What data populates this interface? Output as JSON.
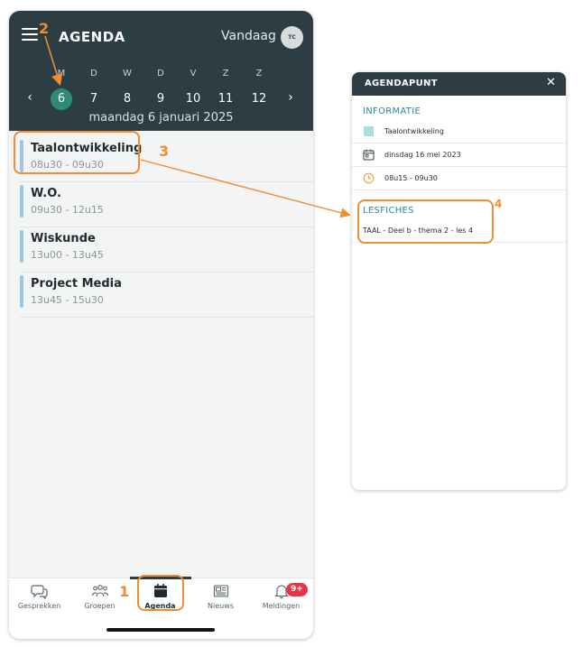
{
  "header": {
    "title": "AGENDA",
    "today_label": "Vandaag",
    "avatar_initials": "TC",
    "weekdays": [
      "M",
      "D",
      "W",
      "D",
      "V",
      "Z",
      "Z"
    ],
    "days": [
      "6",
      "7",
      "8",
      "9",
      "10",
      "11",
      "12"
    ],
    "selected_day": "6",
    "date_line": "maandag 6 januari 2025",
    "prev_icon": "chevron-left-icon",
    "next_icon": "chevron-right-icon",
    "menu_icon": "hamburger-icon"
  },
  "events": [
    {
      "title": "Taalontwikkeling",
      "time": "08u30 - 09u30"
    },
    {
      "title": "W.O.",
      "time": "09u30 - 12u15"
    },
    {
      "title": "Wiskunde",
      "time": "13u00 - 13u45"
    },
    {
      "title": "Project Media",
      "time": "13u45 - 15u30"
    }
  ],
  "tabs": [
    {
      "label": "Gesprekken",
      "icon": "chat-bubbles-icon"
    },
    {
      "label": "Groepen",
      "icon": "people-icon"
    },
    {
      "label": "Agenda",
      "icon": "calendar-icon",
      "active": true
    },
    {
      "label": "Nieuws",
      "icon": "newspaper-icon"
    },
    {
      "label": "Meldingen",
      "icon": "bell-icon",
      "badge": "9+"
    }
  ],
  "panel": {
    "title": "AGENDAPUNT",
    "close_icon": "close-icon",
    "info_heading": "INFORMATIE",
    "subject": "Taalontwikkeling",
    "date": "dinsdag 16 mei 2023",
    "time": "08u15 - 09u30",
    "lesfiches_heading": "LESFICHES",
    "lesfiche": "TAAL - Deel b - thema 2 - les 4"
  },
  "annotations": [
    "1",
    "2",
    "3",
    "4"
  ],
  "colors": {
    "header_bg": "#2c3e44",
    "selected_day": "#2f8a78",
    "event_bar": "#9bc7e6",
    "section_heading": "#2c8a98",
    "annotation": "#f08c32",
    "badge": "#e6354b",
    "subject_swatch": "#a8e0e0"
  }
}
